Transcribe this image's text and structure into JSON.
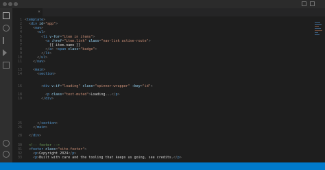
{
  "window": {
    "title": ""
  },
  "tabs": [
    {
      "label": ""
    },
    {
      "label": ""
    }
  ],
  "status": {
    "left": "",
    "right_items": [
      "",
      "",
      "",
      ""
    ]
  }
}
